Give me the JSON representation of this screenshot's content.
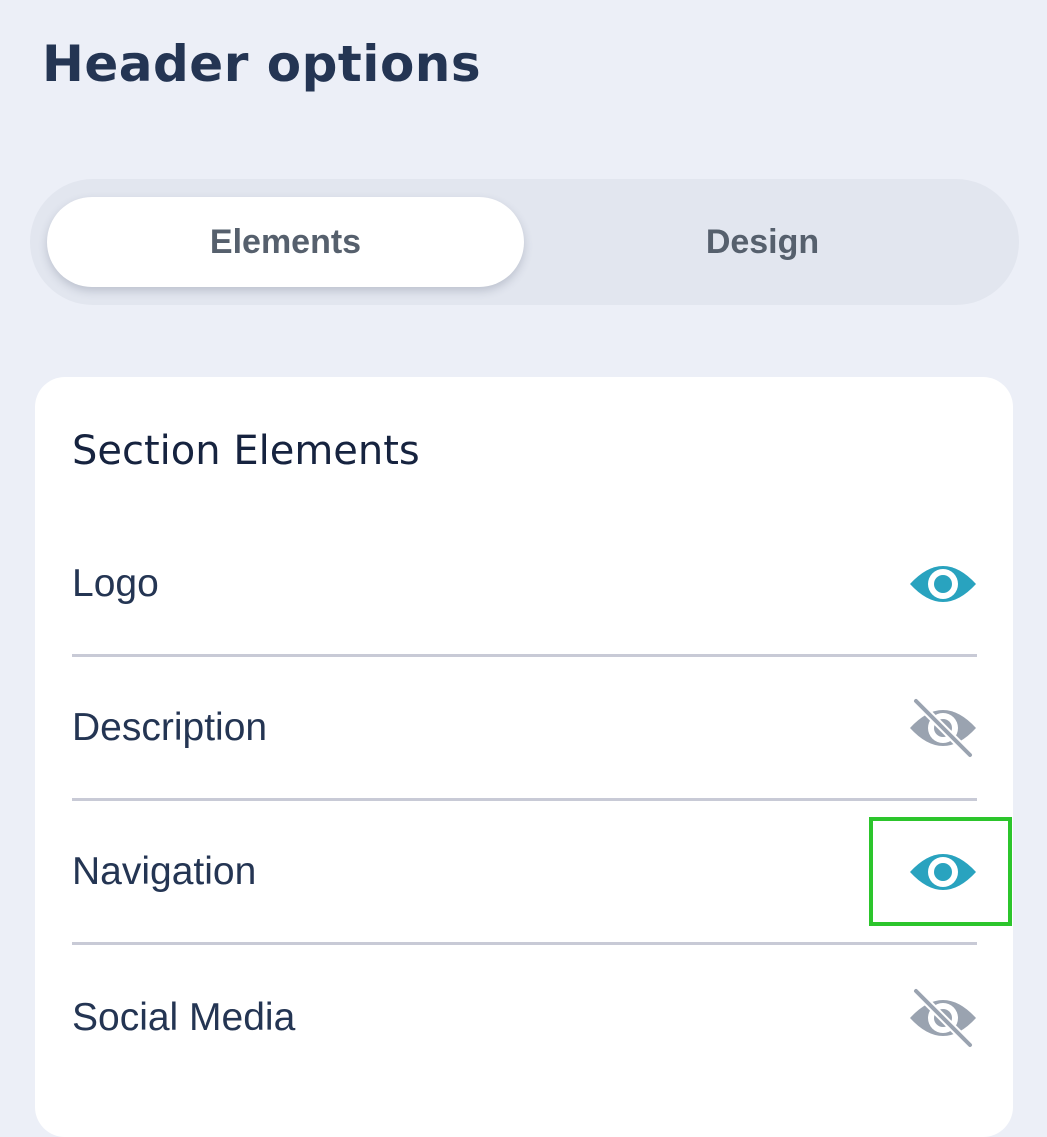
{
  "header": {
    "title": "Header options"
  },
  "tabs": [
    {
      "label": "Elements",
      "active": true
    },
    {
      "label": "Design",
      "active": false
    }
  ],
  "section": {
    "title": "Section Elements",
    "items": [
      {
        "label": "Logo",
        "visible": true,
        "icon": "eye-icon"
      },
      {
        "label": "Description",
        "visible": false,
        "icon": "eye-slash-icon"
      },
      {
        "label": "Navigation",
        "visible": true,
        "icon": "eye-icon",
        "highlighted": true
      },
      {
        "label": "Social Media",
        "visible": false,
        "icon": "eye-slash-icon"
      }
    ]
  },
  "colors": {
    "background": "#ECEFF7",
    "visible_icon": "#29A3BF",
    "hidden_icon": "#9AA3B0",
    "title_text": "#243553",
    "highlight_border": "#2CC52C"
  }
}
